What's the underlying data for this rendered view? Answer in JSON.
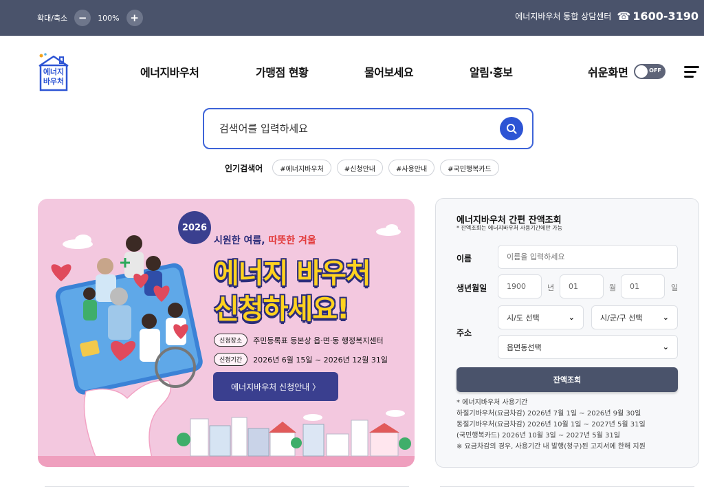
{
  "topbar": {
    "zoom_label": "확대/축소",
    "zoom_out": "−",
    "zoom_value": "100%",
    "zoom_in": "+",
    "hotline_text": "에너지바우처 통합 상담센터",
    "hotline_icon": "☎",
    "hotline_number": "1600-3190"
  },
  "logo": {
    "line1": "에너지",
    "line2": "바우처"
  },
  "nav": {
    "items": [
      {
        "label": "에너지바우처"
      },
      {
        "label": "가맹점 현황"
      },
      {
        "label": "물어보세요"
      },
      {
        "label": "알림·홍보"
      }
    ],
    "easy_view_label": "쉬운화면",
    "toggle_state": "OFF"
  },
  "search": {
    "placeholder": "검색어를 입력하세요",
    "popular_label": "인기검색어",
    "tags": [
      "#에너지바우처",
      "#신청안내",
      "#사용안내",
      "#국민행복카드"
    ]
  },
  "banner": {
    "year": "2026",
    "subtitle_a": "시원한 여름, ",
    "subtitle_b": "따뜻한 겨울",
    "headline1": "에너지 바우처",
    "headline2": "신청하세요!",
    "place_chip": "신청장소",
    "place_text": "주민등록표 등본상 읍·면·동 행정복지센터",
    "period_chip": "신청기간",
    "period_text": "2026년 6월 15일 ~ 2026년 12월 31일",
    "button": "에너지바우처 신청안내 〉"
  },
  "balance": {
    "title": "에너지바우처 간편 잔액조회",
    "note": "* 잔액조회는 에너지바우처 사용기간에만 가능",
    "name_label": "이름",
    "name_placeholder": "이름을 입력하세요",
    "birth_label": "생년월일",
    "year_value": "1900",
    "year_unit": "년",
    "month_value": "01",
    "month_unit": "월",
    "day_value": "01",
    "day_unit": "일",
    "address_label": "주소",
    "sido": "시/도 선택",
    "sigungu": "시/군/구 선택",
    "eupmyeon": "읍면동선택",
    "button": "잔액조회",
    "periods": [
      "* 에너지바우처 사용기간",
      "하절기바우처(요금차감) 2026년 7월 1일 ~ 2026년 9월 30일",
      "동절기바우처(요금차감) 2026년 10월 1일 ~ 2027년 5월 31일",
      "(국민행복카드) 2026년 10월 3일 ~ 2027년 5월 31일",
      "※ 요금차감의 경우, 사용기간 내 발행(청구)된 고지서에 한해 지원"
    ]
  },
  "colors": {
    "topbar": "#4a536b",
    "accent_blue": "#2d54d4",
    "banner_bg": "#f3c8df",
    "banner_navy": "#3a3f8f",
    "headline_yellow": "#ffd21f"
  }
}
